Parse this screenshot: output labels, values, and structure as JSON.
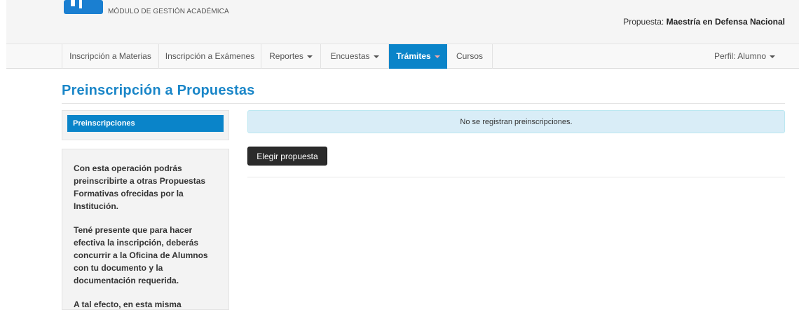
{
  "header": {
    "module_title": "MÓDULO DE GESTIÓN ACADÉMICA",
    "propuesta_label": "Propuesta:",
    "propuesta_value": "Maestría en Defensa Nacional",
    "logo_icon": "institution-logo"
  },
  "nav": {
    "items": [
      {
        "label": "Inscripción a Materias",
        "dropdown": false
      },
      {
        "label": "Inscripción a Exámenes",
        "dropdown": false
      },
      {
        "label": "Reportes",
        "dropdown": true
      },
      {
        "label": "Encuestas",
        "dropdown": true
      },
      {
        "label": "Trámites",
        "dropdown": true,
        "active": true
      },
      {
        "label": "Cursos",
        "dropdown": false
      }
    ],
    "perfil_label": "Perfil: Alumno",
    "active_color": "#0a84c9"
  },
  "page": {
    "title": "Preinscripción a Propuestas",
    "title_color": "#1a86c8"
  },
  "sidebar": {
    "tab_label": "Preinscripciones",
    "info_paragraphs": [
      "Con esta operación podrás preinscribirte a otras Propuestas Formativas ofrecidas por la Institución.",
      "Tené presente que para hacer efectiva la inscripción, deberás concurrir a la Oficina de Alumnos con tu documento y la documentación requerida.",
      "A tal efecto, en esta misma"
    ]
  },
  "main": {
    "alert_text": "No se registran preinscripciones.",
    "button_label": "Elegir propuesta"
  }
}
